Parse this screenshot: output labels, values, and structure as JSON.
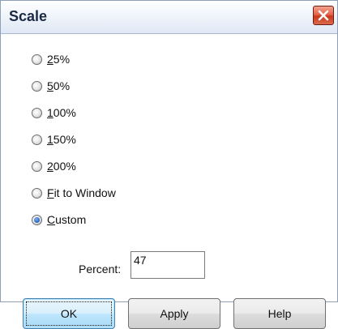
{
  "window": {
    "title": "Scale"
  },
  "scale_options": [
    {
      "mnemonic": "2",
      "rest": "5%",
      "checked": false
    },
    {
      "mnemonic": "5",
      "rest": "0%",
      "checked": false
    },
    {
      "mnemonic": "1",
      "rest": "00%",
      "checked": false
    },
    {
      "mnemonic": "1",
      "rest": "50%",
      "checked": false
    },
    {
      "mnemonic": "2",
      "rest": "00%",
      "checked": false
    },
    {
      "mnemonic": "F",
      "rest": "it to Window",
      "checked": false
    },
    {
      "mnemonic": "C",
      "rest": "ustom",
      "checked": true
    }
  ],
  "percent": {
    "label": "Percent:",
    "value": "47"
  },
  "buttons": {
    "ok": "OK",
    "apply": "Apply",
    "help": "Help"
  }
}
